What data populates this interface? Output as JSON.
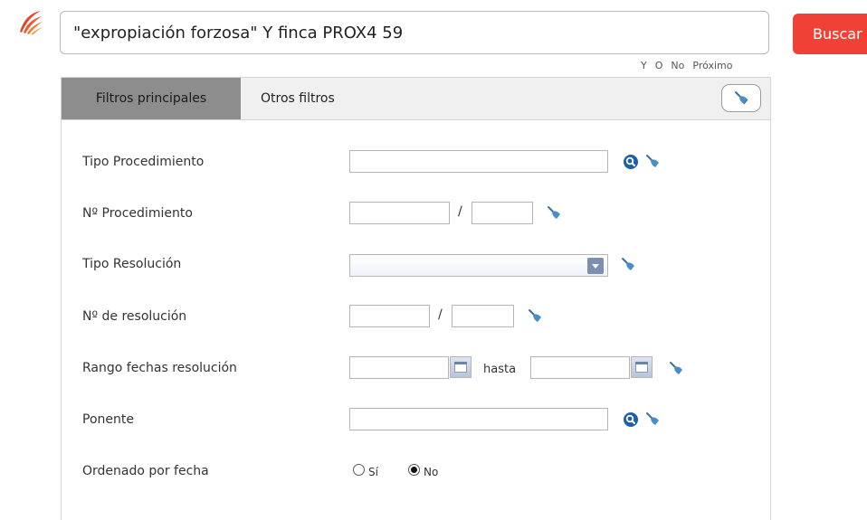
{
  "search": {
    "query": "\"expropiación forzosa\" Y finca PROX4 59",
    "button_label": "Buscar",
    "operators": [
      "Y",
      "O",
      "No",
      "Próximo"
    ]
  },
  "tabs": {
    "main_label": "Filtros principales",
    "other_label": "Otros filtros"
  },
  "filters": {
    "tipo_procedimiento": {
      "label": "Tipo Procedimiento",
      "value": ""
    },
    "num_procedimiento": {
      "label": "Nº Procedimiento",
      "separator": "/",
      "value_1": "",
      "value_2": ""
    },
    "tipo_resolucion": {
      "label": "Tipo Resolución",
      "selected": ""
    },
    "num_resolucion": {
      "label": "Nº de resolución",
      "separator": "/",
      "value_1": "",
      "value_2": ""
    },
    "rango_fechas": {
      "label": "Rango fechas resolución",
      "connector": "hasta",
      "from": "",
      "to": ""
    },
    "ponente": {
      "label": "Ponente",
      "value": ""
    },
    "ordenado": {
      "label": "Ordenado por fecha",
      "option_yes": "Sí",
      "option_no": "No",
      "selected": "No"
    }
  },
  "colors": {
    "accent": "#ef4136",
    "active_tab": "#8d8d8d",
    "icon_blue": "#1f5fa8",
    "broom_blue": "#4a8fc4"
  },
  "icons": [
    "logo-icon",
    "broom-icon",
    "magnifier-icon",
    "calendar-icon",
    "dropdown-arrow-icon"
  ]
}
